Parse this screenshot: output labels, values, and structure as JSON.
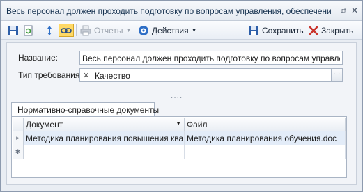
{
  "window": {
    "title": "Весь персонал должен проходить подготовку по вопросам управления, обеспечения и ул...",
    "restore_glyph": "⧉",
    "close_glyph": "✕"
  },
  "toolbar": {
    "reports_label": "Отчеты",
    "actions_label": "Действия",
    "save_label": "Сохранить",
    "close_label": "Закрыть",
    "caret": "▼"
  },
  "form": {
    "name_label": "Название:",
    "name_value": "Весь персонал должен проходить подготовку по вопросам управления,",
    "requirement_type_label": "Тип требования:",
    "requirement_type_value": "Качество",
    "clear_glyph": "✕",
    "ellipsis_glyph": "···",
    "splitter_glyph": "····"
  },
  "tabs": [
    {
      "label": "Нормативно-справочные документы"
    }
  ],
  "grid": {
    "columns": [
      "Документ",
      "Файл"
    ],
    "rows": [
      {
        "document": "Методика планирования повышения квал...",
        "file": "Методика планирования обучения.doc"
      }
    ],
    "current_row_glyph": "▸",
    "new_row_glyph": "✱"
  },
  "colors": {
    "accent": "#1e5fb4",
    "close_red": "#c9322b",
    "header_bg": "#eaeef4"
  }
}
